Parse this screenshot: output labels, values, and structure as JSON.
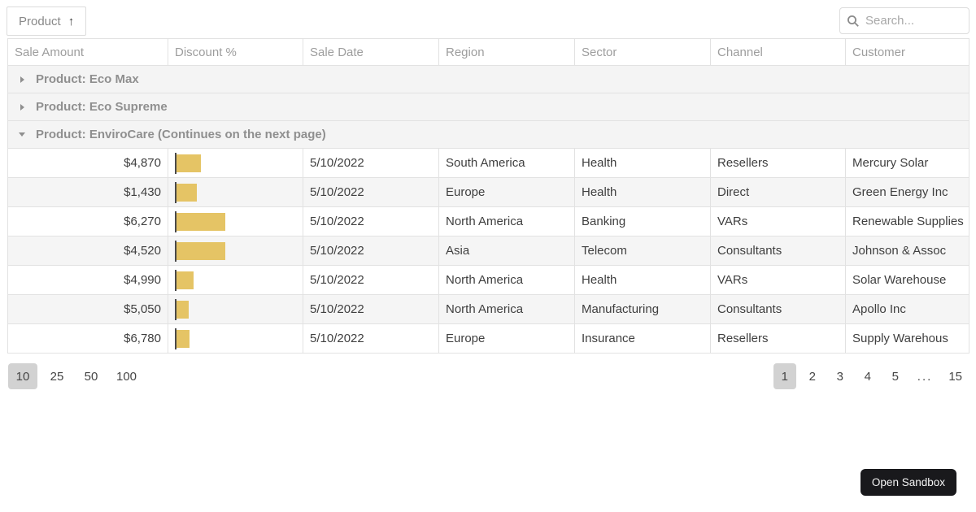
{
  "toolbar": {
    "group_chip": {
      "label": "Product",
      "sort_icon": "↑"
    },
    "search": {
      "placeholder": "Search..."
    }
  },
  "grid": {
    "columns": [
      {
        "label": "Sale Amount",
        "align": "right"
      },
      {
        "label": "Discount %",
        "align": "right"
      },
      {
        "label": "Sale Date",
        "align": "left"
      },
      {
        "label": "Region",
        "align": "left"
      },
      {
        "label": "Sector",
        "align": "left"
      },
      {
        "label": "Channel",
        "align": "left"
      },
      {
        "label": "Customer",
        "align": "left"
      }
    ],
    "groups": [
      {
        "label": "Product: Eco Max",
        "expanded": false
      },
      {
        "label": "Product: Eco Supreme",
        "expanded": false
      },
      {
        "label": "Product: EnviroCare (Continues on the next page)",
        "expanded": true
      }
    ],
    "rows": [
      {
        "sale_amount": "$4,870",
        "bar_pct": 20,
        "sale_date": "5/10/2022",
        "region": "South America",
        "sector": "Health",
        "channel": "Resellers",
        "customer": "Mercury Solar"
      },
      {
        "sale_amount": "$1,430",
        "bar_pct": 17,
        "sale_date": "5/10/2022",
        "region": "Europe",
        "sector": "Health",
        "channel": "Direct",
        "customer": "Green Energy Inc"
      },
      {
        "sale_amount": "$6,270",
        "bar_pct": 40,
        "sale_date": "5/10/2022",
        "region": "North America",
        "sector": "Banking",
        "channel": "VARs",
        "customer": "Renewable Supplies"
      },
      {
        "sale_amount": "$4,520",
        "bar_pct": 40,
        "sale_date": "5/10/2022",
        "region": "Asia",
        "sector": "Telecom",
        "channel": "Consultants",
        "customer": "Johnson & Assoc"
      },
      {
        "sale_amount": "$4,990",
        "bar_pct": 14,
        "sale_date": "5/10/2022",
        "region": "North America",
        "sector": "Health",
        "channel": "VARs",
        "customer": "Solar Warehouse"
      },
      {
        "sale_amount": "$5,050",
        "bar_pct": 10,
        "sale_date": "5/10/2022",
        "region": "North America",
        "sector": "Manufacturing",
        "channel": "Consultants",
        "customer": "Apollo Inc"
      },
      {
        "sale_amount": "$6,780",
        "bar_pct": 11,
        "sale_date": "5/10/2022",
        "region": "Europe",
        "sector": "Insurance",
        "channel": "Resellers",
        "customer": "Supply Warehous"
      }
    ]
  },
  "pager": {
    "page_sizes": [
      "10",
      "25",
      "50",
      "100"
    ],
    "selected_page_size": "10",
    "pages": [
      "1",
      "2",
      "3",
      "4",
      "5",
      "...",
      "15"
    ],
    "selected_page": "1"
  },
  "sandbox_button": {
    "label": "Open Sandbox"
  },
  "colors": {
    "discount_bar": "#e5c465",
    "bar_axis": "#4a4a4a",
    "selected_pager_bg": "#d2d2d2",
    "group_row_bg": "#f4f4f4",
    "alt_row_bg": "#f5f5f5",
    "sandbox_button_bg": "#19191c",
    "border": "#e2e2e2"
  }
}
